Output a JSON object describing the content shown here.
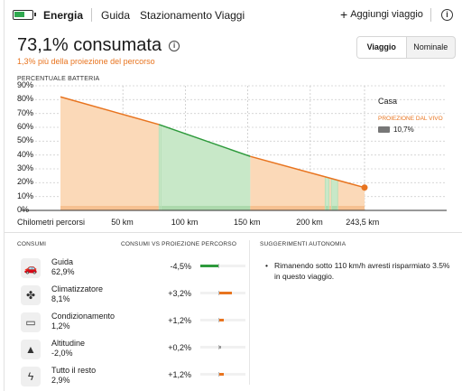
{
  "nav": {
    "tabs": [
      "Energia",
      "Guida",
      "Stazionamento",
      "Viaggi"
    ],
    "add_trip": "Aggiungi viaggio",
    "info": "i"
  },
  "header": {
    "headline": "73,1% consumata",
    "subline": "1,3% più della proiezione del percorso",
    "toggle": [
      "Viaggio",
      "Nominale"
    ],
    "toggle_selected": "Viaggio"
  },
  "chart_title": "PERCENTUALE BATTERIA",
  "legend": {
    "home": "Casa",
    "projection": "PROIEZIONE DAL VIVO",
    "projection_value": "10,7%"
  },
  "chart_data": {
    "type": "area",
    "title": "PERCENTUALE BATTERIA",
    "xlabel": "Chilometri percorsi",
    "ylabel": "",
    "y_ticks": [
      "90%",
      "80%",
      "70%",
      "60%",
      "50%",
      "40%",
      "30%",
      "20%",
      "10%",
      "0%"
    ],
    "x_ticks": [
      {
        "value": 0,
        "label": "Chilometri percorsi"
      },
      {
        "value": 50,
        "label": "50 km"
      },
      {
        "value": 100,
        "label": "100 km"
      },
      {
        "value": 150,
        "label": "150 km"
      },
      {
        "value": 200,
        "label": "200 km"
      },
      {
        "value": 243.5,
        "label": "243,5 km"
      }
    ],
    "xlim": [
      0,
      243.5
    ],
    "ylim": [
      0,
      90
    ],
    "line": {
      "x": [
        0,
        79,
        152,
        243.5
      ],
      "y": [
        82,
        62,
        39,
        16.5
      ],
      "colors": [
        "#e8741f",
        "#2e9a3c",
        "#e8741f"
      ]
    },
    "segments": [
      {
        "x0": 0,
        "x1": 79,
        "status": "over",
        "color": "#fbd9b8"
      },
      {
        "x0": 79,
        "x1": 80.5,
        "status": "under",
        "color": "#c8e8c8"
      },
      {
        "x0": 80.5,
        "x1": 152,
        "status": "under",
        "color": "#c8e8c8"
      },
      {
        "x0": 152,
        "x1": 212,
        "status": "over",
        "color": "#fbd9b8"
      },
      {
        "x0": 212,
        "x1": 215,
        "status": "under",
        "color": "#c8e8c8"
      },
      {
        "x0": 215,
        "x1": 217,
        "status": "over",
        "color": "#fbd9b8"
      },
      {
        "x0": 217,
        "x1": 222,
        "status": "under",
        "color": "#c8e8c8"
      },
      {
        "x0": 222,
        "x1": 243.5,
        "status": "over",
        "color": "#fbd9b8"
      }
    ],
    "end_point": {
      "x": 243.5,
      "y": 16.5,
      "color": "#e8741f"
    },
    "projection_end": {
      "x": 243.5,
      "y": 10.7
    },
    "grid": true,
    "legend_position": "right"
  },
  "sections": {
    "consumption": "CONSUMI",
    "vs_projection": "CONSUMI VS PROIEZIONE PERCORSO",
    "tips": "SUGGERIMENTI AUTONOMIA"
  },
  "consumption": [
    {
      "label": "Guida",
      "value": "62,9%",
      "delta": "-4,5%",
      "delta_num": -4.5,
      "icon": "car-icon"
    },
    {
      "label": "Climatizzatore",
      "value": "8,1%",
      "delta": "+3,2%",
      "delta_num": 3.2,
      "icon": "fan-icon"
    },
    {
      "label": "Condizionamento",
      "value": "1,2%",
      "delta": "+1,2%",
      "delta_num": 1.2,
      "icon": "battery-conditioning-icon"
    },
    {
      "label": "Altitudine",
      "value": "-2,0%",
      "delta": "+0,2%",
      "delta_num": 0.2,
      "icon": "mountain-icon"
    },
    {
      "label": "Tutto il resto",
      "value": "2,9%",
      "delta": "+1,2%",
      "delta_num": 1.2,
      "icon": "lightning-icon"
    }
  ],
  "colors": {
    "accent_orange": "#e8741f",
    "accent_green": "#2e9a3c"
  },
  "tip": "Rimanendo sotto 110 km/h avresti risparmiato 3.5% in questo viaggio."
}
